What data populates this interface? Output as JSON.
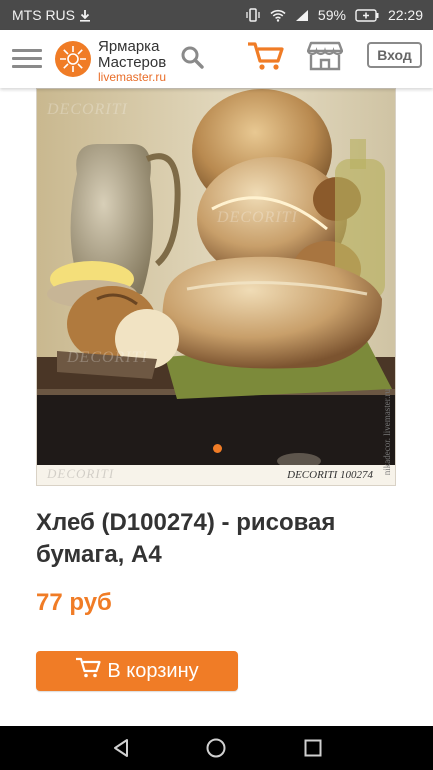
{
  "status_bar": {
    "carrier": "MTS RUS",
    "battery": "59%",
    "time": "22:29"
  },
  "header": {
    "logo_line1": "Ярмарка",
    "logo_line2": "Мастеров",
    "logo_domain": "livemaster.ru",
    "login_label": "Вход"
  },
  "product": {
    "title": "Хлеб (D100274) - рисовая бумага, А4",
    "price": "77 руб",
    "add_to_cart_label": "В корзину",
    "image_caption": "DECORITI  100274",
    "image_side_watermark": "nikadecor. livemaster.ru",
    "image_watermark": "DECORITI"
  },
  "colors": {
    "accent": "#f07c26",
    "status_bar": "#4a4a4a",
    "nav_bar": "#000000"
  },
  "icons": {
    "menu": "hamburger-icon",
    "search": "search-icon",
    "cart": "cart-icon",
    "shop": "shop-icon",
    "back": "back-icon",
    "home": "home-icon",
    "recents": "recents-icon"
  }
}
